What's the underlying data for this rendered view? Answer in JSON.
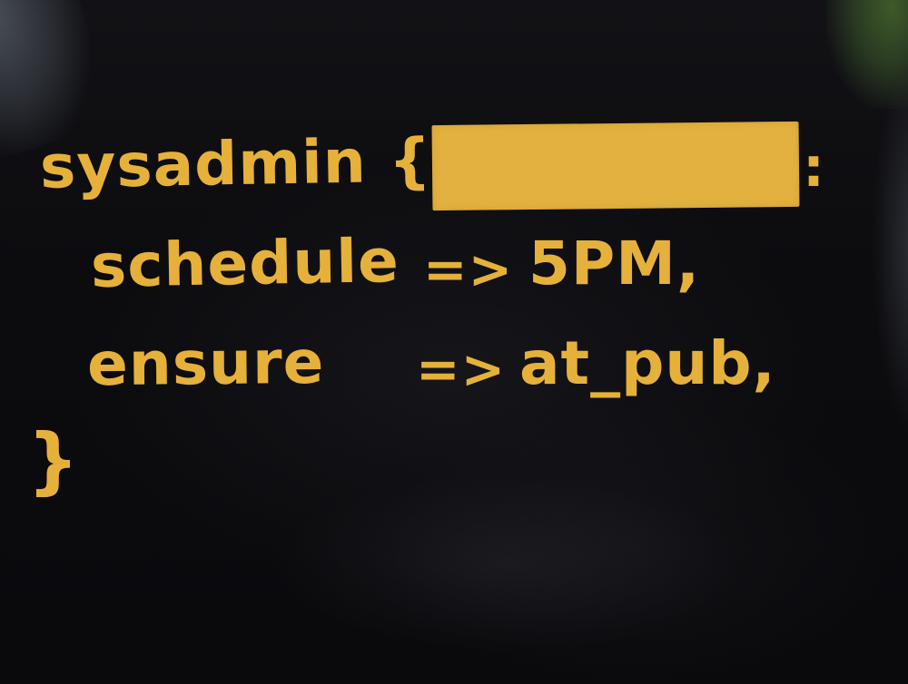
{
  "shirt_print": {
    "line1": {
      "keyword": "sysadmin",
      "brace_open": "{",
      "colon": ":"
    },
    "line2": {
      "key": "schedule",
      "arrow": "=>",
      "value": "5PM,"
    },
    "line3": {
      "key": "ensure",
      "arrow": "=>",
      "value": "at_pub,"
    },
    "line4": {
      "brace_close": "}"
    }
  },
  "colors": {
    "fabric": "#0b0b0e",
    "print": "#e6b13a",
    "redaction": "#e3b13f"
  }
}
